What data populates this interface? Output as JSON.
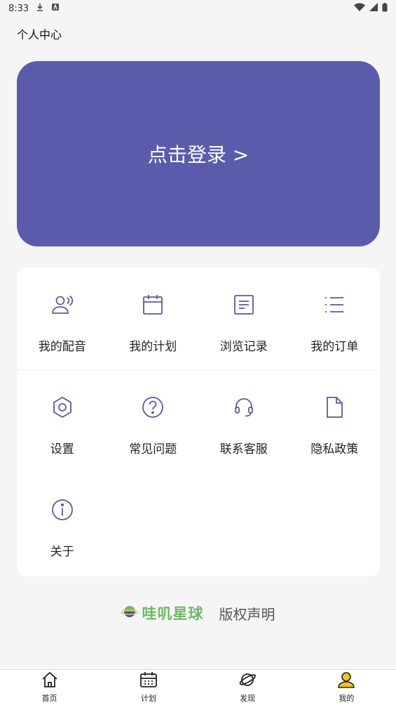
{
  "status_bar": {
    "time": "8:33"
  },
  "page": {
    "title": "个人中心"
  },
  "login": {
    "label": "点击登录 >"
  },
  "menu": {
    "items": [
      {
        "label": "我的配音",
        "icon": "voice-user-icon"
      },
      {
        "label": "我的计划",
        "icon": "calendar-icon"
      },
      {
        "label": "浏览记录",
        "icon": "document-icon"
      },
      {
        "label": "我的订单",
        "icon": "list-icon"
      },
      {
        "label": "设置",
        "icon": "settings-icon"
      },
      {
        "label": "常见问题",
        "icon": "question-icon"
      },
      {
        "label": "联系客服",
        "icon": "headset-icon"
      },
      {
        "label": "隐私政策",
        "icon": "file-icon"
      },
      {
        "label": "关于",
        "icon": "info-icon"
      }
    ]
  },
  "footer": {
    "brand_name": "哇叽星球",
    "copyright": "版权声明"
  },
  "tab_bar": {
    "tabs": [
      {
        "label": "首页",
        "icon": "home-icon"
      },
      {
        "label": "计划",
        "icon": "calendar-icon"
      },
      {
        "label": "发现",
        "icon": "planet-icon"
      },
      {
        "label": "我的",
        "icon": "user-icon",
        "active": true
      }
    ]
  },
  "colors": {
    "accent": "#5a5cab",
    "icon": "#5a5a9a",
    "brand_green": "#6dbb62",
    "active_tab": "#f5c518"
  }
}
